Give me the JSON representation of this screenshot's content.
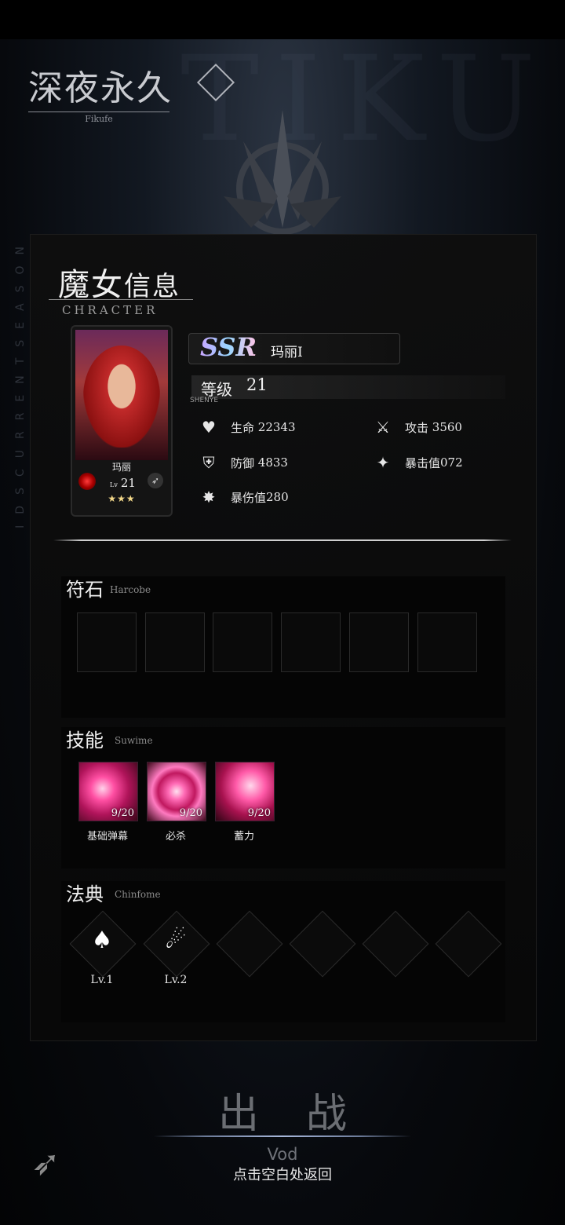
{
  "logo": {
    "title": "深夜永久",
    "subtitle": "Fikufe"
  },
  "background": {
    "deco_text": "TIKU",
    "side_text": "IDSCURRENTSEASON"
  },
  "panel": {
    "title_big": "魔女",
    "title_small": "信息",
    "subtitle": "CHRACTER"
  },
  "card": {
    "name": "玛丽",
    "lv_label": "Lv",
    "level": "21",
    "stars": "★★★"
  },
  "hero": {
    "rarity": "SSR",
    "name": "玛丽I",
    "level_label": "等级",
    "level": "21",
    "tag": "SHENYE"
  },
  "stats": [
    {
      "icon": "heart-icon",
      "label": "生命",
      "value": "22343"
    },
    {
      "icon": "sword-icon",
      "label": "攻击",
      "value": "3560"
    },
    {
      "icon": "shield-icon",
      "label": "防御",
      "value": "4833"
    },
    {
      "icon": "crit-icon",
      "label": "暴击值",
      "value": "072"
    },
    {
      "icon": "crit-damage-icon",
      "label": "暴伤值",
      "value": "280"
    }
  ],
  "runes": {
    "title": "符石",
    "subtitle": "Harcobe",
    "slots": 6
  },
  "skills": {
    "title": "技能",
    "subtitle": "Suwime",
    "items": [
      {
        "name": "基础弹幕",
        "count": "9/20"
      },
      {
        "name": "必杀",
        "count": "9/20"
      },
      {
        "name": "蓄力",
        "count": "9/20"
      }
    ]
  },
  "tomes": {
    "title": "法典",
    "subtitle": "Chinfome",
    "items": [
      {
        "icon": "ghost-flame-icon",
        "level": "Lv.1"
      },
      {
        "icon": "comet-icon",
        "level": "Lv.2"
      }
    ]
  },
  "footer": {
    "battle": "出战",
    "vod": "Vod",
    "back_hint": "点击空白处返回"
  },
  "colors": {
    "accent_pink": "#ff4fa3",
    "gold_star": "#f4d98a",
    "panel_bg": "#0e0e0e"
  }
}
